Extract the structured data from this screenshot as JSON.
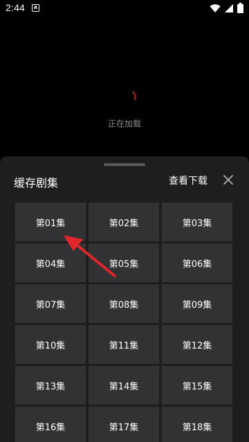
{
  "status_bar": {
    "time": "2:44",
    "a_icon_letter": "A"
  },
  "player": {
    "loading_text": "正在加载"
  },
  "sheet": {
    "title": "缓存剧集",
    "view_downloads_label": "查看下载",
    "close_icon": "close-icon"
  },
  "episodes": [
    {
      "label": "第01集"
    },
    {
      "label": "第02集"
    },
    {
      "label": "第03集"
    },
    {
      "label": "第04集"
    },
    {
      "label": "第05集"
    },
    {
      "label": "第06集"
    },
    {
      "label": "第07集"
    },
    {
      "label": "第08集"
    },
    {
      "label": "第09集"
    },
    {
      "label": "第10集"
    },
    {
      "label": "第11集"
    },
    {
      "label": "第12集"
    },
    {
      "label": "第13集"
    },
    {
      "label": "第14集"
    },
    {
      "label": "第15集"
    },
    {
      "label": "第16集"
    },
    {
      "label": "第17集"
    },
    {
      "label": "第18集"
    }
  ],
  "colors": {
    "sheet_background": "#1e1e1f",
    "episode_button": "#323235",
    "annotation_arrow": "#e0252b"
  }
}
